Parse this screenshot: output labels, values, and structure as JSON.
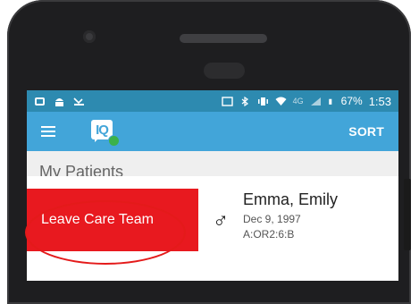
{
  "status_bar": {
    "battery": "67%",
    "time": "1:53",
    "network_label": "4G"
  },
  "app_bar": {
    "logo_text": "IQ",
    "sort_label": "SORT"
  },
  "main": {
    "section_title": "My Patients",
    "swipe_action_label": "Leave Care Team",
    "patient": {
      "name": "Emma, Emily",
      "dob": "Dec 9, 1997",
      "location": "A:OR2:6:B",
      "gender_icon": "male-icon"
    }
  },
  "colors": {
    "status_bar": "#2d8ab0",
    "app_bar": "#42a5d9",
    "action_red": "#e8191f",
    "logo_dot": "#3bb14b",
    "annotation": "#e41a1a"
  }
}
